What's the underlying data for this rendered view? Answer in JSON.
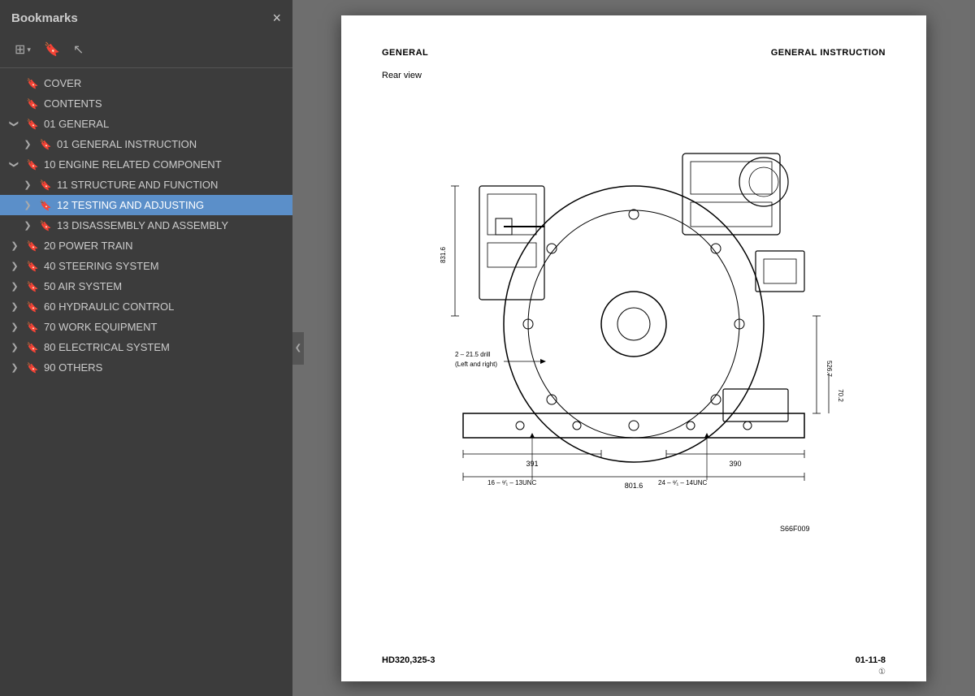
{
  "sidebar": {
    "title": "Bookmarks",
    "close_label": "×",
    "toolbar": {
      "list_icon": "☰",
      "dropdown_icon": "▾",
      "bookmark_icon": "🔖"
    },
    "items": [
      {
        "id": "cover",
        "label": "COVER",
        "level": 0,
        "toggle": "empty",
        "active": false
      },
      {
        "id": "contents",
        "label": "CONTENTS",
        "level": 0,
        "toggle": "empty",
        "active": false
      },
      {
        "id": "01-general",
        "label": "01 GENERAL",
        "level": 0,
        "toggle": "open",
        "active": false
      },
      {
        "id": "01-general-instruction",
        "label": "01 GENERAL INSTRUCTION",
        "level": 1,
        "toggle": "closed",
        "active": false
      },
      {
        "id": "10-engine",
        "label": "10 ENGINE RELATED COMPONENT",
        "level": 0,
        "toggle": "open",
        "active": false
      },
      {
        "id": "11-structure",
        "label": "11 STRUCTURE AND FUNCTION",
        "level": 1,
        "toggle": "closed",
        "active": false
      },
      {
        "id": "12-testing",
        "label": "12 TESTING AND ADJUSTING",
        "level": 1,
        "toggle": "closed",
        "active": true
      },
      {
        "id": "13-disassembly",
        "label": "13 DISASSEMBLY AND ASSEMBLY",
        "level": 1,
        "toggle": "closed",
        "active": false
      },
      {
        "id": "20-power-train",
        "label": "20 POWER TRAIN",
        "level": 0,
        "toggle": "closed",
        "active": false
      },
      {
        "id": "40-steering",
        "label": "40 STEERING SYSTEM",
        "level": 0,
        "toggle": "closed",
        "active": false
      },
      {
        "id": "50-air-system",
        "label": "50 AIR SYSTEM",
        "level": 0,
        "toggle": "closed",
        "active": false
      },
      {
        "id": "60-hydraulic",
        "label": "60 HYDRAULIC CONTROL",
        "level": 0,
        "toggle": "closed",
        "active": false
      },
      {
        "id": "70-work-equipment",
        "label": "70 WORK EQUIPMENT",
        "level": 0,
        "toggle": "closed",
        "active": false
      },
      {
        "id": "80-electrical",
        "label": "80 ELECTRICAL SYSTEM",
        "level": 0,
        "toggle": "closed",
        "active": false
      },
      {
        "id": "90-others",
        "label": "90 OTHERS",
        "level": 0,
        "toggle": "closed",
        "active": false
      }
    ]
  },
  "page": {
    "header_left": "GENERAL",
    "header_right": "GENERAL INSTRUCTION",
    "rear_view_label": "Rear view",
    "footer_left": "HD320,325-3",
    "footer_right": "01-11-8",
    "footnote": "①"
  },
  "collapse_arrow": "❮"
}
